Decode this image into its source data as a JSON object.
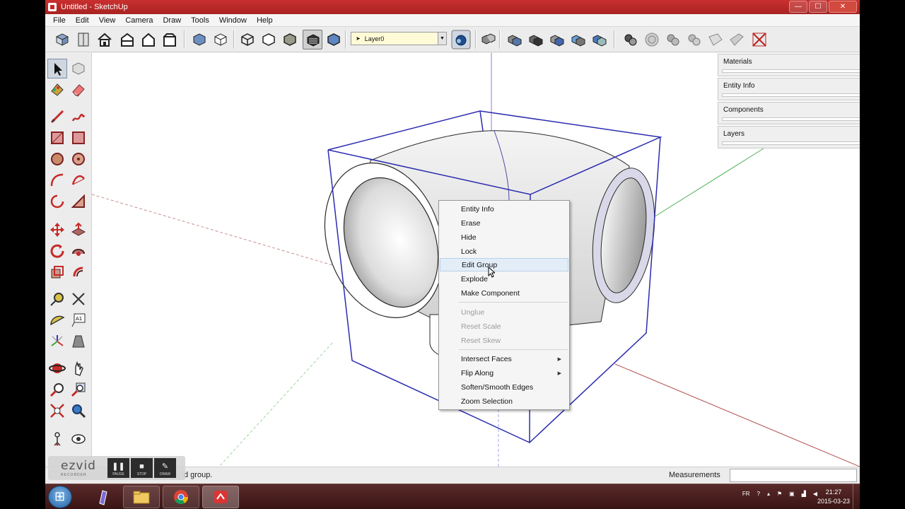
{
  "window": {
    "title": "Untitled - SketchUp",
    "minimize": "—",
    "maximize": "☐",
    "close": "✕"
  },
  "menubar": {
    "items": [
      "File",
      "Edit",
      "View",
      "Camera",
      "Draw",
      "Tools",
      "Window",
      "Help"
    ]
  },
  "toolbar": {
    "layer_value": "Layer0",
    "layer_arrow": "▼"
  },
  "trays": [
    {
      "title": "Materials",
      "close": "0"
    },
    {
      "title": "Entity Info",
      "close": "0"
    },
    {
      "title": "Components",
      "close": "0"
    },
    {
      "title": "Layers",
      "close": "0"
    }
  ],
  "context_menu": {
    "items": [
      {
        "label": "Entity Info",
        "enabled": true
      },
      {
        "label": "Erase",
        "enabled": true
      },
      {
        "label": "Hide",
        "enabled": true
      },
      {
        "label": "Lock",
        "enabled": true
      },
      {
        "label": "Edit Group",
        "enabled": true,
        "hover": true
      },
      {
        "label": "Explode",
        "enabled": true
      },
      {
        "label": "Make Component",
        "enabled": true
      },
      {
        "label": "Unglue",
        "enabled": false
      },
      {
        "label": "Reset Scale",
        "enabled": false
      },
      {
        "label": "Reset Skew",
        "enabled": false
      },
      {
        "label": "Intersect Faces",
        "enabled": true,
        "submenu": "▶"
      },
      {
        "label": "Flip Along",
        "enabled": true,
        "submenu": "▶"
      },
      {
        "label": "Soften/Smooth Edges",
        "enabled": true
      },
      {
        "label": "Zoom Selection",
        "enabled": true
      }
    ]
  },
  "statusbar": {
    "message": "d group.",
    "measurements_label": "Measurements",
    "measurements_value": ""
  },
  "ezvid": {
    "logo": "ezvid",
    "sub": "RECORDER",
    "buttons": [
      {
        "label": "PAUSE",
        "glyph": "❚❚"
      },
      {
        "label": "STOP",
        "glyph": "■"
      },
      {
        "label": "DRAW",
        "glyph": "✎"
      }
    ]
  },
  "taskbar": {
    "lang": "FR",
    "time": "21:27",
    "date": "2015-03-23"
  },
  "colors": {
    "titlebar": "#b62927",
    "selection_box": "#2b2bb0",
    "axis_red": "#b45050",
    "axis_green": "#4caf50",
    "axis_blue": "#3a3ad0",
    "layer_bg": "#fffbd6"
  }
}
